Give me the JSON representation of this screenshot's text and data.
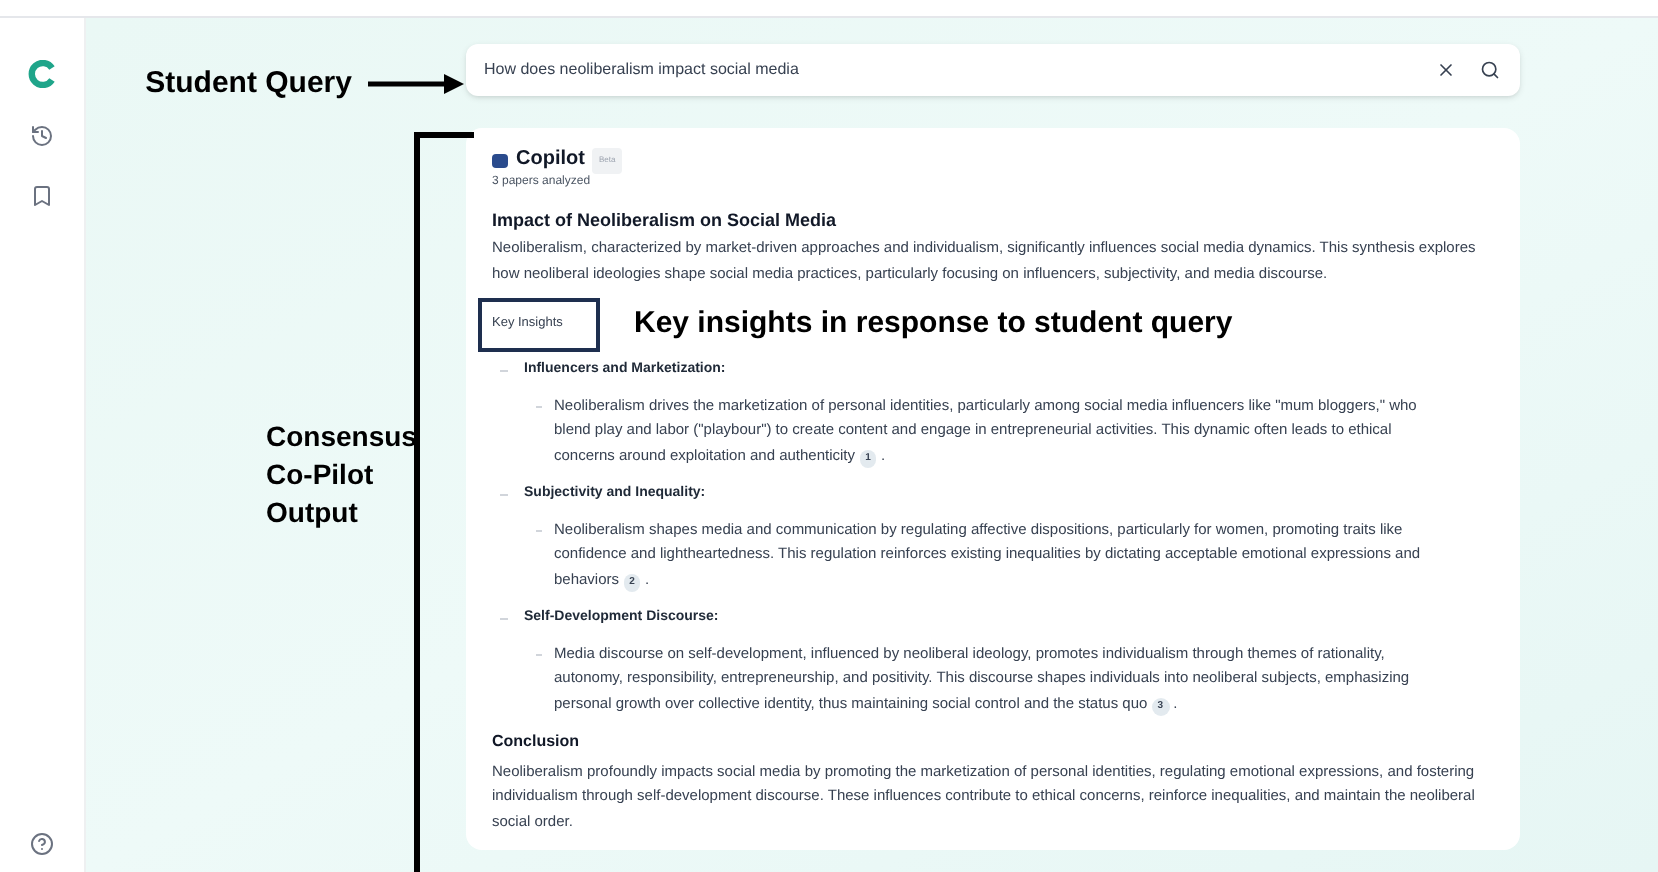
{
  "annotations": {
    "query_label": "Student Query",
    "output_label": "Consensus Co-Pilot Output",
    "insights_label": "Key insights in response to student query"
  },
  "sidebar": {
    "items": [
      {
        "kind": "logo"
      },
      {
        "kind": "history"
      },
      {
        "kind": "bookmark"
      }
    ],
    "footer": {
      "kind": "help"
    }
  },
  "search": {
    "value": "How does neoliberalism impact social media"
  },
  "card": {
    "brand": "Copilot",
    "badge": "Beta",
    "subtitle": "3 papers analyzed",
    "title": "Impact of Neoliberalism on Social Media",
    "intro": "Neoliberalism, characterized by market-driven approaches and individualism, significantly influences social media dynamics. This synthesis explores how neoliberal ideologies shape social media practices, particularly focusing on influencers, subjectivity, and media discourse.",
    "tab": {
      "label": "Key Insights",
      "selected": true
    },
    "insights": [
      {
        "heading": "Influencers and Marketization:",
        "text": "Neoliberalism drives the marketization of personal identities, particularly among social media influencers like \"mum bloggers,\" who blend play and labor (\"playbour\") to create content and engage in entrepreneurial activities. This dynamic often leads to ethical concerns around exploitation and authenticity",
        "citation": "1",
        "end": "."
      },
      {
        "heading": "Subjectivity and Inequality:",
        "text": "Neoliberalism shapes media and communication by regulating affective dispositions, particularly for women, promoting traits like confidence and lightheartedness. This regulation reinforces existing inequalities by dictating acceptable emotional expressions and behaviors",
        "citation": "2",
        "end": "."
      },
      {
        "heading": "Self-Development Discourse:",
        "text": "Media discourse on self-development, influenced by neoliberal ideology, promotes individualism through themes of rationality, autonomy, responsibility, entrepreneurship, and positivity. This discourse shapes individuals into neoliberal subjects, emphasizing personal growth over collective identity, thus maintaining social control and the status quo",
        "citation": "3",
        "end": "."
      }
    ],
    "conclusion_title": "Conclusion",
    "conclusion": "Neoliberalism profoundly impacts social media by promoting the marketization of personal identities, regulating emotional expressions, and fostering individualism through self-development discourse. These influences contribute to ethical concerns, reinforce inequalities, and maintain the neoliberal social order."
  }
}
